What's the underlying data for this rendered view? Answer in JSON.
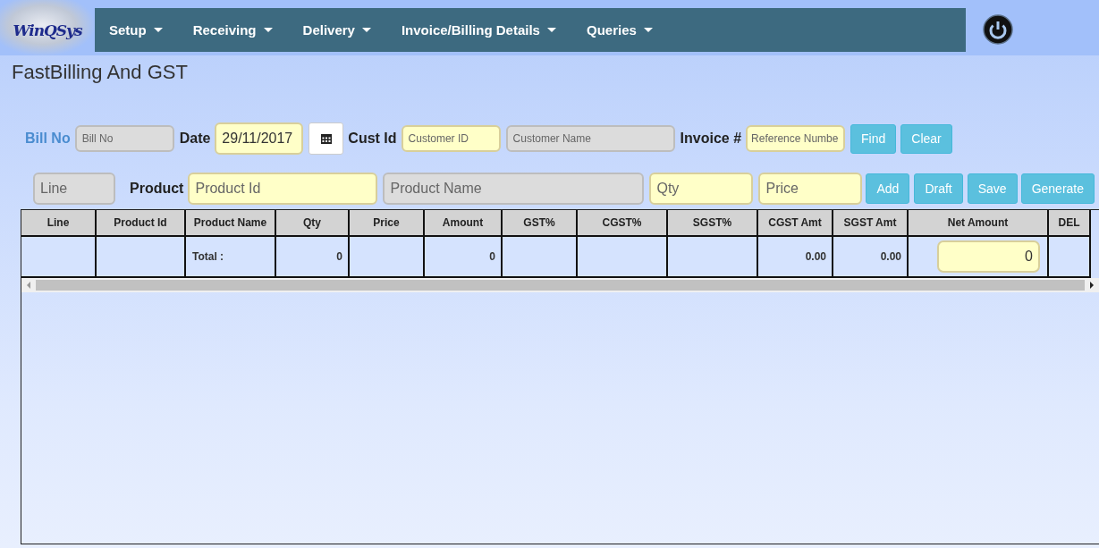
{
  "logo": {
    "text": "WinQSys"
  },
  "menu": [
    {
      "label": "Setup"
    },
    {
      "label": "Receiving"
    },
    {
      "label": "Delivery"
    },
    {
      "label": "Invoice/Billing Details"
    },
    {
      "label": "Queries"
    }
  ],
  "page_title": "FastBilling And GST",
  "search_row": [
    {
      "kind": "label",
      "text": "Bill No",
      "accent": true
    },
    {
      "kind": "field",
      "placeholder": "Bill No",
      "disabled": true
    },
    {
      "kind": "label",
      "text": "Date",
      "accent": false
    },
    {
      "kind": "field",
      "value": "29/11/2017",
      "disabled": false
    },
    {
      "kind": "calendar"
    },
    {
      "kind": "label",
      "text": "Cust Id",
      "accent": false
    },
    {
      "kind": "field",
      "placeholder": "Customer ID",
      "disabled": false
    },
    {
      "kind": "field",
      "placeholder": "Customer Name",
      "disabled": true
    },
    {
      "kind": "label",
      "text": "Invoice #",
      "accent": false
    },
    {
      "kind": "field",
      "placeholder": "Reference Numbe",
      "disabled": false
    },
    {
      "kind": "button",
      "text": "Find"
    },
    {
      "kind": "button",
      "text": "Clear"
    }
  ],
  "entry_row": [
    {
      "kind": "field",
      "placeholder": "Line",
      "disabled": true
    },
    {
      "kind": "label",
      "text": "Product",
      "accent": false
    },
    {
      "kind": "field",
      "placeholder": "Product Id",
      "disabled": false
    },
    {
      "kind": "field",
      "placeholder": "Product Name",
      "disabled": true
    },
    {
      "kind": "field",
      "placeholder": "Qty",
      "disabled": false
    },
    {
      "kind": "field",
      "placeholder": "Price",
      "disabled": false
    },
    {
      "kind": "button",
      "text": "Add"
    },
    {
      "kind": "button",
      "text": "Draft"
    },
    {
      "kind": "button",
      "text": "Save"
    },
    {
      "kind": "button",
      "text": "Generate"
    }
  ],
  "table": {
    "columns": [
      "Line",
      "Product Id",
      "Product Name",
      "Qty",
      "Price",
      "Amount",
      "GST%",
      "CGST%",
      "SGST%",
      "CGST Amt",
      "SGST Amt",
      "Net Amount",
      "DEL"
    ],
    "total_row": [
      {
        "kind": "blank"
      },
      {
        "kind": "blank"
      },
      {
        "kind": "text",
        "text": "Total :"
      },
      {
        "kind": "text",
        "text": "0"
      },
      {
        "kind": "blank"
      },
      {
        "kind": "text",
        "text": "0"
      },
      {
        "kind": "blank"
      },
      {
        "kind": "blank"
      },
      {
        "kind": "blank"
      },
      {
        "kind": "text",
        "text": "0.00"
      },
      {
        "kind": "text",
        "text": "0.00"
      },
      {
        "kind": "field",
        "value": "0"
      },
      {
        "kind": "blank"
      }
    ]
  }
}
